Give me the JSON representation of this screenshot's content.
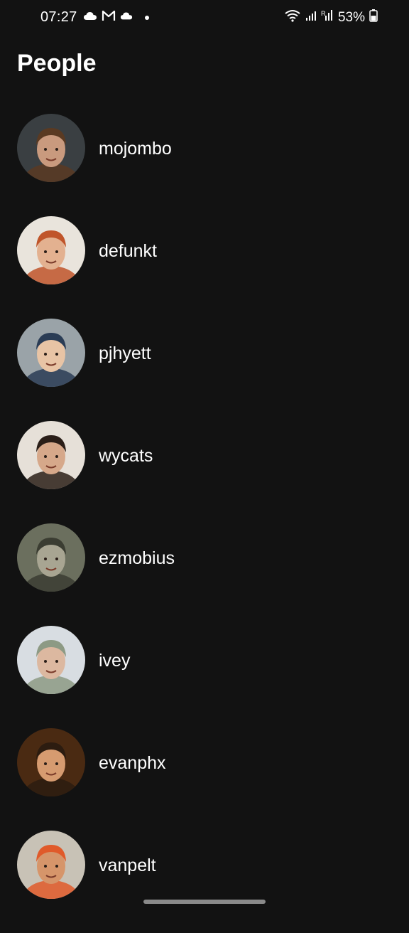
{
  "status_bar": {
    "time": "07:27",
    "left_icons": [
      "cloud-icon",
      "gmail-icon",
      "cloud-icon",
      "dot-icon"
    ],
    "right_icons": [
      "wifi-icon",
      "signal-icon",
      "signal-r-icon"
    ],
    "battery_percent": "53%",
    "battery_level": 0.53
  },
  "header": {
    "title": "People"
  },
  "people": [
    {
      "name": "mojombo",
      "avatar_colors": [
        "#3a3f42",
        "#c99a7e",
        "#5a3a22"
      ]
    },
    {
      "name": "defunkt",
      "avatar_colors": [
        "#e9e4dc",
        "#e3b190",
        "#c0552a"
      ]
    },
    {
      "name": "pjhyett",
      "avatar_colors": [
        "#9aa3a8",
        "#e8c4a5",
        "#2a3c55"
      ]
    },
    {
      "name": "wycats",
      "avatar_colors": [
        "#e6e0d8",
        "#d6a88a",
        "#2a1e18"
      ]
    },
    {
      "name": "ezmobius",
      "avatar_colors": [
        "#6b6f5e",
        "#a8a592",
        "#3b3d32"
      ]
    },
    {
      "name": "ivey",
      "avatar_colors": [
        "#d8dde2",
        "#dcb8a0",
        "#8d9a84"
      ]
    },
    {
      "name": "evanphx",
      "avatar_colors": [
        "#4a2a12",
        "#d69b70",
        "#2c1c10"
      ]
    },
    {
      "name": "vanpelt",
      "avatar_colors": [
        "#c8c2b6",
        "#d6956a",
        "#e05a2a"
      ]
    }
  ]
}
